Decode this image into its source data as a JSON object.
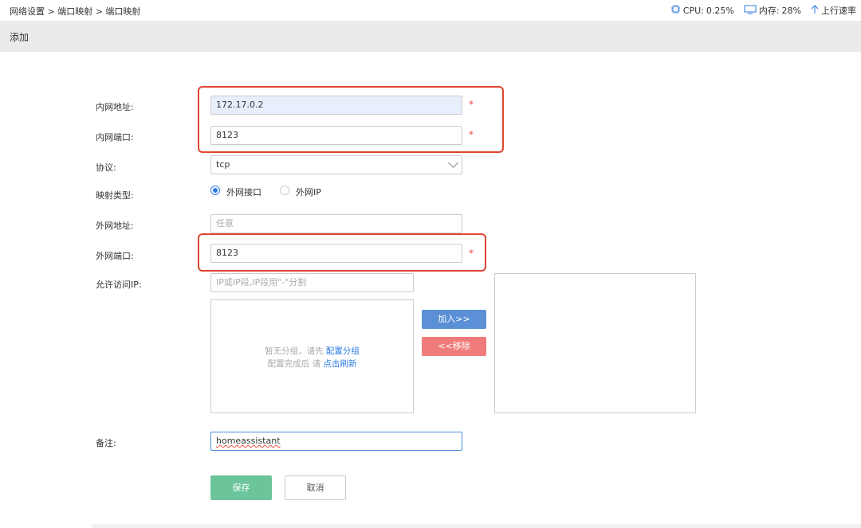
{
  "breadcrumb": "网络设置 > 端口映射 > 端口映射",
  "status": {
    "cpu_label": "CPU:",
    "cpu_value": "0.25%",
    "mem_label": "内存:",
    "mem_value": "28%",
    "upload_label": "上行速率",
    "cpu_icon": "chip-icon",
    "mem_icon": "monitor-icon",
    "upload_icon": "arrow-up-icon"
  },
  "page_title": "添加",
  "form": {
    "lan_addr_label": "内网地址:",
    "lan_addr_value": "172.17.0.2",
    "lan_port_label": "内网端口:",
    "lan_port_value": "8123",
    "protocol_label": "协议:",
    "protocol_value": "tcp",
    "map_type_label": "映射类型:",
    "map_type_options": [
      "外网接口",
      "外网IP"
    ],
    "map_type_selected": "外网接口",
    "wan_addr_label": "外网地址:",
    "wan_addr_placeholder": "任意",
    "wan_port_label": "外网端口:",
    "wan_port_value": "8123",
    "allow_ip_label": "允许访问IP:",
    "allow_ip_placeholder": "IP或IP段,IP段用\"-\"分割",
    "group_empty_line1_prefix": "暂无分组，请先",
    "group_empty_line1_link": "配置分组",
    "group_empty_line2_prefix": "配置完成后 请",
    "group_empty_line2_link": "点击刷新",
    "add_button": "加入>>",
    "remove_button": "<<移除",
    "remark_label": "备注:",
    "remark_value": "homeassistant",
    "required_mark": "*"
  },
  "actions": {
    "save": "保存",
    "cancel": "取消"
  },
  "colors": {
    "accent": "#2a7ae2",
    "required": "#e84c3d",
    "highlight_box": "#e0452f",
    "save_button": "#6cc59a",
    "add_button": "#5b8fd6",
    "remove_button": "#ef7b7b"
  }
}
